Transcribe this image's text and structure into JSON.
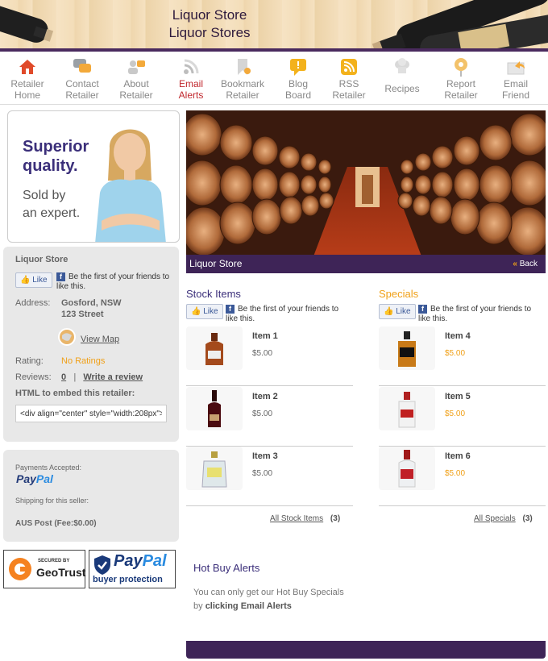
{
  "header": {
    "title": "Liquor Store",
    "subtitle": "Liquor Stores"
  },
  "nav": [
    {
      "line1": "Retailer",
      "line2": "Home",
      "icon": "home-icon",
      "color": "#e04a2a"
    },
    {
      "line1": "Contact",
      "line2": "Retailer",
      "icon": "chat-bubbles-icon",
      "color": "#9aa0a6"
    },
    {
      "line1": "About",
      "line2": "Retailer",
      "icon": "people-icon",
      "color": "#f3a93a"
    },
    {
      "line1": "Email",
      "line2": "Alerts",
      "icon": "rss-icon",
      "color": "#bfbfbf"
    },
    {
      "line1": "Bookmark",
      "line2": "Retailer",
      "icon": "bookmark-icon",
      "color": "#ccc"
    },
    {
      "line1": "Blog",
      "line2": "Board",
      "icon": "blog-icon",
      "color": "#f3b21c"
    },
    {
      "line1": "RSS",
      "line2": "Retailer",
      "icon": "rss-feed-icon",
      "color": "#f3b21c"
    },
    {
      "line1": "Recipes",
      "line2": "",
      "icon": "chef-hat-icon",
      "color": "#bbb"
    },
    {
      "line1": "Report",
      "line2": "Retailer",
      "icon": "report-pin-icon",
      "color": "#f3a93a"
    },
    {
      "line1": "Email",
      "line2": "Friend",
      "icon": "forward-mail-icon",
      "color": "#ddd"
    }
  ],
  "promo": {
    "line1": "Superior",
    "line2": "quality.",
    "line3": "Sold by",
    "line4": "an expert."
  },
  "retailer": {
    "name": "Liquor Store",
    "like": "Like",
    "fb_text": "Be the first of your friends to like this.",
    "address_label": "Address:",
    "address_line1": "Gosford, NSW",
    "address_line2": "123 Street",
    "view_map": "View Map",
    "rating_label": "Rating:",
    "rating_value": "No Ratings",
    "reviews_label": "Reviews:",
    "reviews_count": "0",
    "write_review": "Write a review",
    "embed_label": "HTML to embed this retailer:",
    "embed_code": "<div align=\"center\" style=\"width:208px\">"
  },
  "payment": {
    "accepted_label": "Payments Accepted:",
    "paypal_a": "Pay",
    "paypal_b": "Pal",
    "shipping_label": "Shipping for this seller:",
    "shipping_value": "AUS Post (Fee:$0.00)"
  },
  "badges": {
    "geotrust_small": "SECURED BY",
    "geotrust": "GeoTrust",
    "pp_a": "Pay",
    "pp_b": "Pal",
    "pp_sub": "buyer protection"
  },
  "hero": {
    "caption": "Liquor Store",
    "back": "Back"
  },
  "stock": {
    "title": "Stock Items",
    "all_label": "All Stock Items",
    "count": "(3)",
    "items": [
      {
        "name": "Item 1",
        "price": "$5.00"
      },
      {
        "name": "Item 2",
        "price": "$5.00"
      },
      {
        "name": "Item 3",
        "price": "$5.00"
      }
    ]
  },
  "specials": {
    "title": "Specials",
    "all_label": "All Specials",
    "count": "(3)",
    "items": [
      {
        "name": "Item 4",
        "price": "$5.00"
      },
      {
        "name": "Item 5",
        "price": "$5.00"
      },
      {
        "name": "Item 6",
        "price": "$5.00"
      }
    ]
  },
  "hot": {
    "title": "Hot Buy Alerts",
    "text": "You can only get our Hot Buy Specials by",
    "link": "clicking Email Alerts"
  }
}
